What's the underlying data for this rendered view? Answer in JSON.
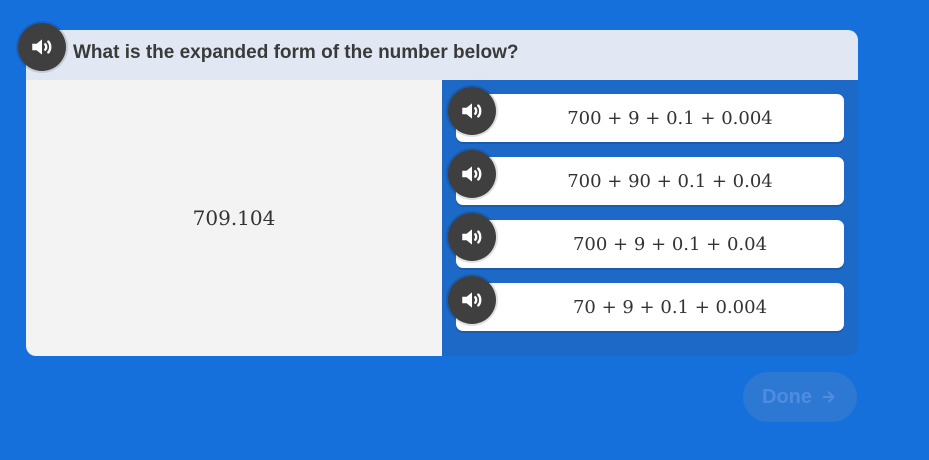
{
  "question": {
    "text": "What is the expanded form of the number below?",
    "stem": "709.104"
  },
  "options": [
    {
      "label": "700 + 9 + 0.1 + 0.004"
    },
    {
      "label": "700 + 90 + 0.1 + 0.04"
    },
    {
      "label": "700 + 9 + 0.1 + 0.04"
    },
    {
      "label": "70 + 9 + 0.1 + 0.004"
    }
  ],
  "done_button": {
    "label": "Done",
    "icon": "arrow-right-icon"
  },
  "icons": {
    "speaker": "speaker-icon"
  },
  "colors": {
    "background": "#1670dc",
    "header": "#e1e7f3",
    "stem_area": "#f3f3f3",
    "speaker_button": "#3f3f3f",
    "done_button": "#2c78d3",
    "done_text": "#4f8ce0"
  }
}
